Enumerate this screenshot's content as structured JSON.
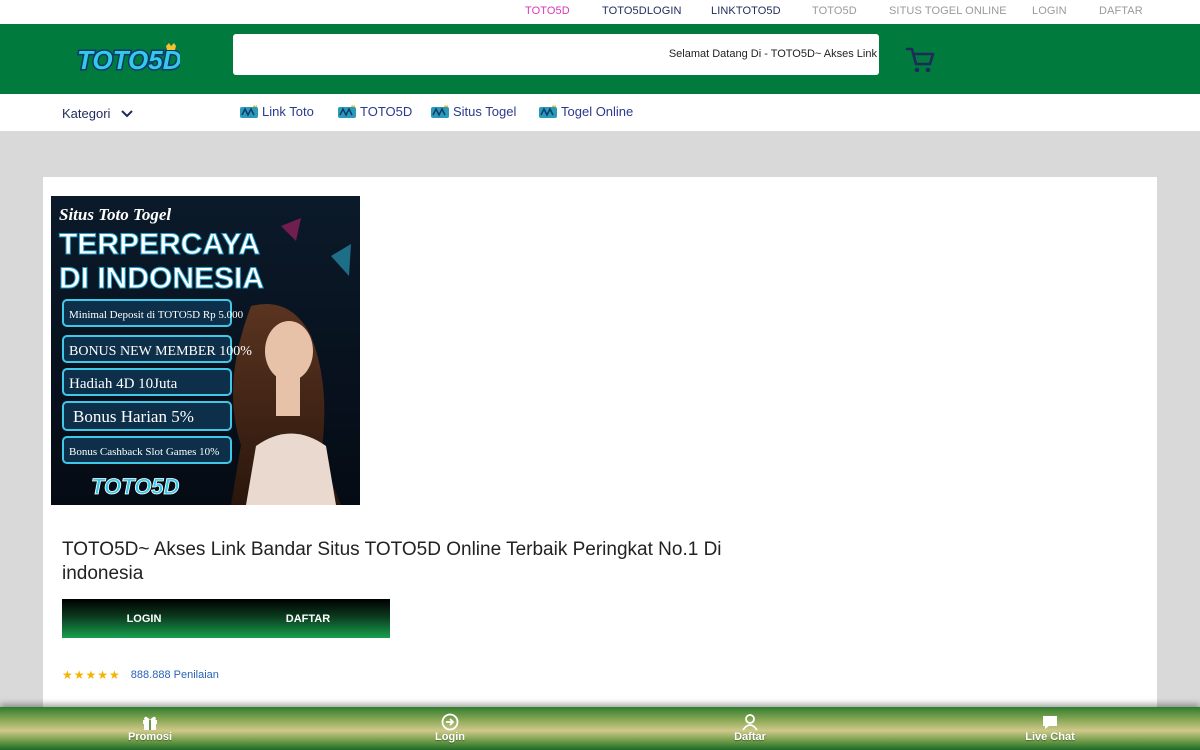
{
  "top_links": [
    {
      "label": "TOTO5D",
      "color": "#d63ab5"
    },
    {
      "label": "TOTO5DLOGIN",
      "color": "#1f2a5a"
    },
    {
      "label": "LINKTOTO5D",
      "color": "#1f2a5a"
    },
    {
      "label": "TOTO5D",
      "color": "#9a9a9a"
    },
    {
      "label": "SITUS TOGEL ONLINE",
      "color": "#9a9a9a"
    },
    {
      "label": "LOGIN",
      "color": "#9a9a9a"
    },
    {
      "label": "DAFTAR",
      "color": "#9a9a9a"
    }
  ],
  "header": {
    "logo_text": "TOTO5D",
    "marquee_text": "Selamat Datang Di - TOTO5D~ Akses Link",
    "cart_icon": "shopping-cart-icon",
    "color": "#007a3d"
  },
  "nav": {
    "kategori": "Kategori",
    "links": [
      "Link Toto",
      "TOTO5D",
      "Situs Togel",
      "Togel Online"
    ]
  },
  "banner": {
    "script_line": "Situs Toto Togel",
    "headline1": "TERPERCAYA",
    "headline2": "DI INDONESIA",
    "promos": [
      "Minimal Deposit di TOTO5D Rp 5.000",
      "BONUS NEW MEMBER 100%",
      "Hadiah 4D 10Juta",
      "Bonus Harian 5%",
      "Bonus Cashback Slot Games 10%"
    ],
    "logo": "TOTO5D"
  },
  "product": {
    "title": "TOTO5D~ Akses Link Bandar Situs TOTO5D Online Terbaik Peringkat No.1 Di indonesia",
    "login_label": "LOGIN",
    "daftar_label": "DAFTAR",
    "stars": "★★★★★",
    "rating_value": 5,
    "rating_count": "888.888 Penilaian"
  },
  "bottom_nav": [
    {
      "label": "Promosi",
      "icon": "gift-icon"
    },
    {
      "label": "Login",
      "icon": "login-icon"
    },
    {
      "label": "Daftar",
      "icon": "user-icon"
    },
    {
      "label": "Live Chat",
      "icon": "chat-icon"
    }
  ]
}
